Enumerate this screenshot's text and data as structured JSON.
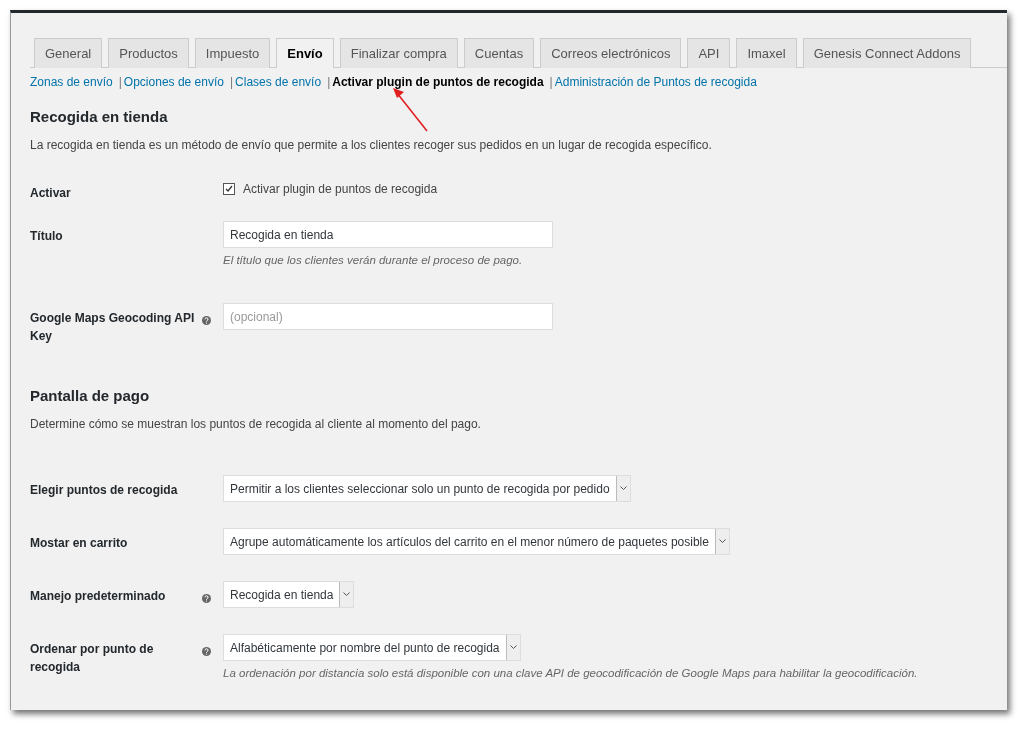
{
  "tabs": [
    {
      "label": "General",
      "selected": false
    },
    {
      "label": "Productos",
      "selected": false
    },
    {
      "label": "Impuesto",
      "selected": false
    },
    {
      "label": "Envío",
      "selected": true
    },
    {
      "label": "Finalizar compra",
      "selected": false
    },
    {
      "label": "Cuentas",
      "selected": false
    },
    {
      "label": "Correos electrónicos",
      "selected": false
    },
    {
      "label": "API",
      "selected": false
    },
    {
      "label": "Imaxel",
      "selected": false
    },
    {
      "label": "Genesis Connect Addons",
      "selected": false
    }
  ],
  "subnav": [
    {
      "label": "Zonas de envío",
      "selected": false
    },
    {
      "separator": "|",
      "label": "Opciones de envío",
      "selected": false
    },
    {
      "separator": "|",
      "label": "Clases de envío",
      "selected": false
    },
    {
      "separator": "|",
      "label": "Activar plugin de puntos de recogida",
      "selected": true
    },
    {
      "separator": "|",
      "label": "Administración de Puntos de recogida",
      "selected": false
    }
  ],
  "sections": [
    {
      "title": "Recogida en tienda",
      "description": "La recogida en tienda es un método de envío que permite a los clientes recoger sus pedidos en un lugar de recogida específico.",
      "fields": [
        {
          "kind": "checkbox",
          "label": "Activar",
          "help": false,
          "checked": true,
          "text": "Activar plugin de puntos de recogida"
        },
        {
          "kind": "text",
          "label": "Título",
          "help": false,
          "value": "Recogida en tienda",
          "hint": "El título que los clientes verán durante el proceso de pago."
        },
        {
          "kind": "text",
          "label": "Google Maps Geocoding API Key",
          "help": true,
          "placeholder": "(opcional)"
        }
      ]
    },
    {
      "title": "Pantalla de pago",
      "description": "Determine cómo se muestran los puntos de recogida al cliente al momento del pago.",
      "fields": [
        {
          "kind": "select",
          "label": "Elegir puntos de recogida",
          "help": false,
          "value": "Permitir a los clientes seleccionar solo un punto de recogida por pedido"
        },
        {
          "kind": "select",
          "label": "Mostar en carrito",
          "help": false,
          "value": "Agrupe automáticamente los artículos del carrito en el menor número de paquetes posible"
        },
        {
          "kind": "select",
          "label": "Manejo predeterminado",
          "help": true,
          "value": "Recogida en tienda"
        },
        {
          "kind": "select",
          "label": "Ordenar por punto de recogida",
          "help": true,
          "value": "Alfabéticamente por nombre del punto de recogida",
          "hint": "La ordenación por distancia solo está disponible con una clave API de geocodificación de Google Maps para habilitar la geocodificación."
        }
      ]
    }
  ]
}
